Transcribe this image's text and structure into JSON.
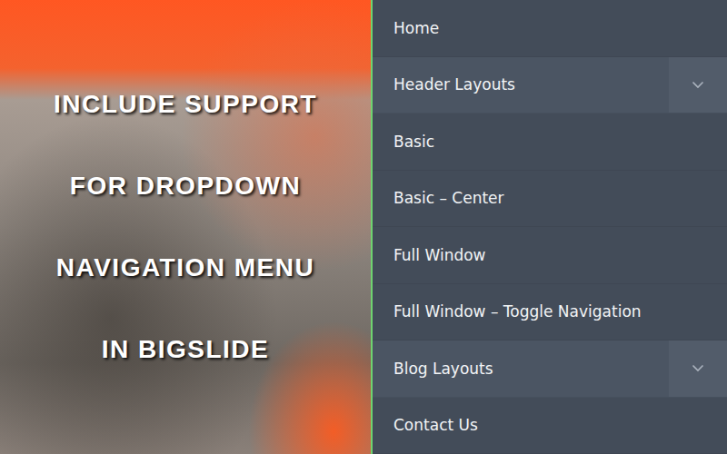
{
  "banner": {
    "headline": [
      "INCLUDE SUPPORT",
      "FOR DROPDOWN",
      "NAVIGATION MENU",
      "IN BIGSLIDE"
    ]
  },
  "menu": {
    "items": [
      {
        "label": "Home",
        "kind": "link",
        "expanded": false
      },
      {
        "label": "Header Layouts",
        "kind": "parent",
        "expanded": true
      },
      {
        "label": "Basic",
        "kind": "child",
        "expanded": false
      },
      {
        "label": "Basic – Center",
        "kind": "child",
        "expanded": false
      },
      {
        "label": "Full Window",
        "kind": "child",
        "expanded": false
      },
      {
        "label": "Full Window – Toggle Navigation",
        "kind": "child",
        "expanded": false
      },
      {
        "label": "Blog Layouts",
        "kind": "parent",
        "expanded": false
      },
      {
        "label": "Contact Us",
        "kind": "link",
        "expanded": false
      }
    ]
  }
}
